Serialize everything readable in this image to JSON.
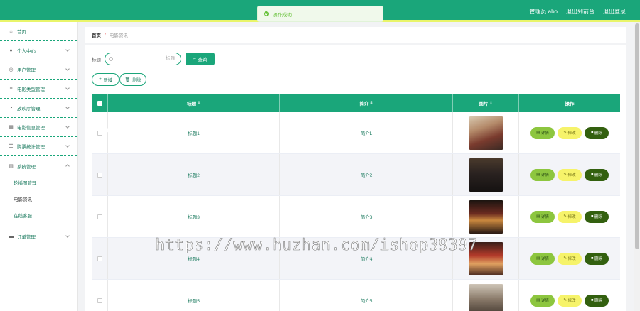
{
  "header": {
    "admin_label": "管理员 abo",
    "back_home": "退出到前台",
    "logout": "退出登录",
    "accent": "#1aa67a",
    "stripe": "#e9f56a"
  },
  "toast": {
    "message": "操作成功",
    "icon": "success-check-icon"
  },
  "sidebar": {
    "items": [
      {
        "label": "首页",
        "icon": "home-icon"
      },
      {
        "label": "个人中心",
        "icon": "user-icon"
      },
      {
        "label": "用户管理",
        "icon": "users-icon"
      },
      {
        "label": "电影类型管理",
        "icon": "list-icon"
      },
      {
        "label": "放映厅管理",
        "icon": "hall-icon"
      },
      {
        "label": "电影信息管理",
        "icon": "grid-icon"
      },
      {
        "label": "购票统计管理",
        "icon": "chart-icon"
      },
      {
        "label": "系统管理",
        "icon": "system-icon"
      },
      {
        "label": "订单管理",
        "icon": "order-icon"
      }
    ],
    "submenu": [
      "轮播图管理",
      "电影资讯",
      "在线客服"
    ]
  },
  "breadcrumb": {
    "home": "首页",
    "separator": "/",
    "current": "电影资讯"
  },
  "search": {
    "label": "标题",
    "placeholder": "标题",
    "button": "查询"
  },
  "actions": {
    "add": "新增",
    "delete": "删除"
  },
  "table": {
    "headers": {
      "title": "标题",
      "intro": "简介",
      "image": "图片",
      "op": "操作"
    },
    "ops": {
      "detail": "详情",
      "edit": "修改",
      "delete": "删除"
    },
    "rows": [
      {
        "title": "标题1",
        "intro": "简介1"
      },
      {
        "title": "标题2",
        "intro": "简介2"
      },
      {
        "title": "标题3",
        "intro": "简介3"
      },
      {
        "title": "标题4",
        "intro": "简介4"
      },
      {
        "title": "标题5",
        "intro": "简介5"
      }
    ]
  },
  "watermark": "https://www.huzhan.com/ishop39397"
}
